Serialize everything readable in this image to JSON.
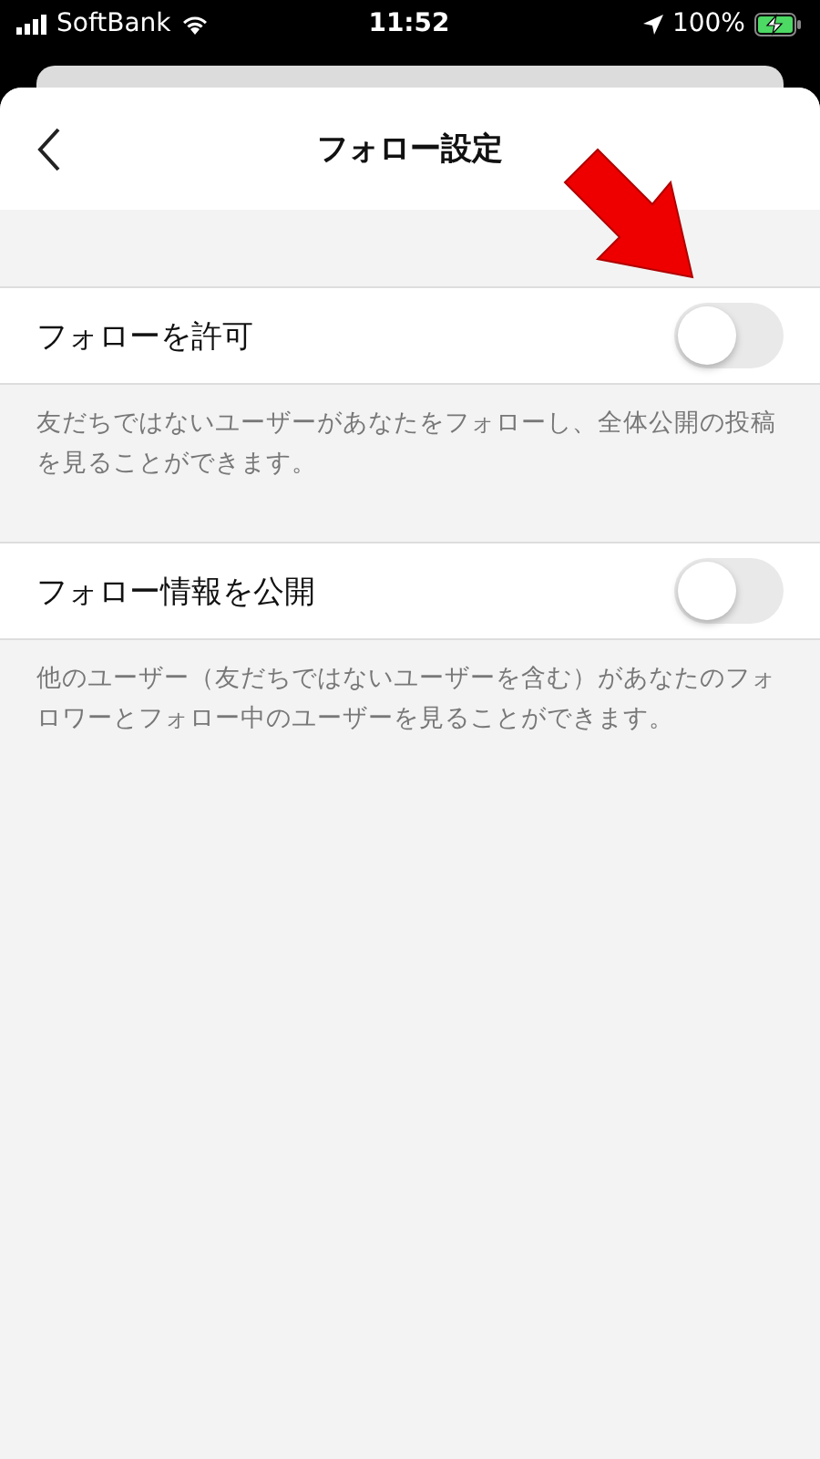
{
  "status_bar": {
    "carrier": "SoftBank",
    "time": "11:52",
    "battery": "100%"
  },
  "header": {
    "title": "フォロー設定"
  },
  "settings": [
    {
      "label": "フォローを許可",
      "on": false,
      "description": "友だちではないユーザーがあなたをフォローし、全体公開の投稿を見ることができます。"
    },
    {
      "label": "フォロー情報を公開",
      "on": false,
      "description": "他のユーザー（友だちではないユーザーを含む）があなたのフォロワーとフォロー中のユーザーを見ることができます。"
    }
  ]
}
